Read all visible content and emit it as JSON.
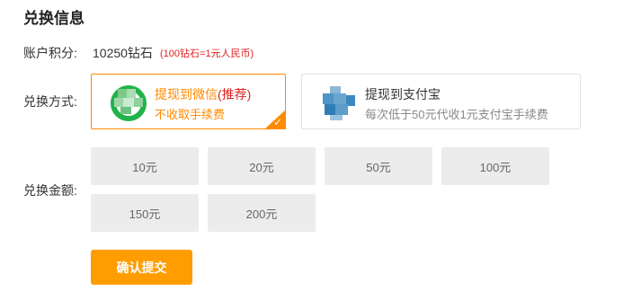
{
  "section_title": "兑换信息",
  "account": {
    "label": "账户积分:",
    "balance": "10250钻石",
    "rate_note": "(100钻石=1元人民币)"
  },
  "method": {
    "label": "兑换方式:",
    "options": [
      {
        "icon": "wechat-icon",
        "name": "提现到微信",
        "tag": "(推荐)",
        "desc": "不收取手续费",
        "selected": true,
        "accent": "#ff8a00"
      },
      {
        "icon": "alipay-icon",
        "name": "提现到支付宝",
        "desc": "每次低于50元代收1元支付宝手续费",
        "selected": false
      }
    ]
  },
  "amount": {
    "label": "兑换金额:",
    "options": [
      "10元",
      "20元",
      "50元",
      "100元",
      "150元",
      "200元"
    ]
  },
  "submit_label": "确认提交",
  "colors": {
    "accent_orange": "#ff9d00",
    "selected_border": "#ff8a00",
    "note_red": "#e02020",
    "amount_bg": "#ececec"
  }
}
